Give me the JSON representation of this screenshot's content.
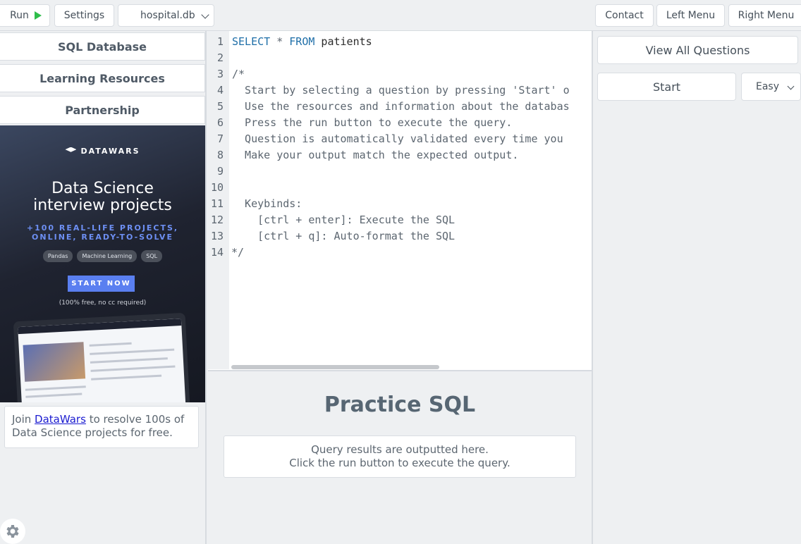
{
  "toolbar": {
    "run_label": "Run",
    "settings_label": "Settings",
    "database_selected": "hospital.db",
    "contact_label": "Contact",
    "left_menu_label": "Left Menu",
    "right_menu_label": "Right Menu"
  },
  "sidebar": {
    "items": [
      {
        "label": "SQL Database"
      },
      {
        "label": "Learning Resources"
      },
      {
        "label": "Partnership"
      }
    ],
    "ad": {
      "brand": "DATAWARS",
      "title_line1": "Data Science",
      "title_line2": "interview projects",
      "subtitle_line1": "+100 REAL-LIFE PROJECTS,",
      "subtitle_line2": "ONLINE, READY-TO-SOLVE",
      "tags": [
        "Pandas",
        "Machine Learning",
        "SQL"
      ],
      "cta": "START NOW",
      "note": "(100% free, no cc required)"
    },
    "join": {
      "prefix": "Join ",
      "link": "DataWars",
      "suffix": " to resolve 100s of Data Science projects for free."
    }
  },
  "editor": {
    "lines": [
      "1",
      "2",
      "3",
      "4",
      "5",
      "6",
      "7",
      "8",
      "9",
      "10",
      "11",
      "12",
      "13",
      "14"
    ],
    "code": {
      "line1_kw1": "SELECT",
      "line1_star": " * ",
      "line1_kw2": "FROM",
      "line1_table": " patients",
      "line3": "/*",
      "line4": "  Start by selecting a question by pressing 'Start' o",
      "line5": "  Use the resources and information about the databas",
      "line6": "  Press the run button to execute the query.",
      "line7": "  Question is automatically validated every time you",
      "line8": "  Make your output match the expected output.",
      "line11": "  Keybinds:",
      "line12": "    [ctrl + enter]: Execute the SQL",
      "line13": "    [ctrl + q]: Auto-format the SQL",
      "line14": "*/"
    }
  },
  "results": {
    "title": "Practice SQL",
    "message_line1": "Query results are outputted here.",
    "message_line2": "Click the run button to execute the query."
  },
  "right_panel": {
    "view_all_label": "View All Questions",
    "start_label": "Start",
    "difficulty_selected": "Easy"
  },
  "colors": {
    "run_icon": "#2ebd4a",
    "keyword": "#1f6fa8",
    "link": "#1b1bd0",
    "ad_accent": "#5a7ff0"
  }
}
